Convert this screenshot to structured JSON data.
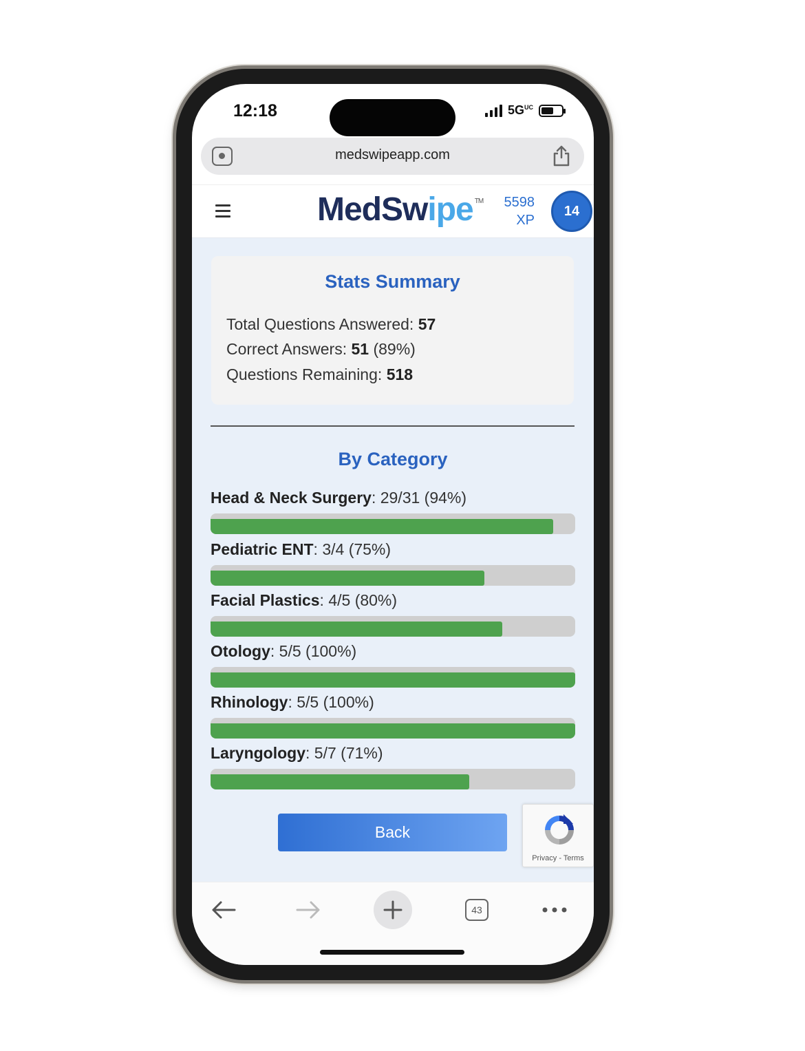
{
  "status_bar": {
    "time": "12:18",
    "network": "5G",
    "network_suffix": "UC"
  },
  "browser": {
    "url": "medswipeapp.com",
    "tabs_count": "43"
  },
  "header": {
    "logo_part1": "MedSw",
    "logo_part2": "ipe",
    "logo_tm": "TM",
    "xp_value": "5598",
    "xp_unit": "XP",
    "level": "14"
  },
  "summary": {
    "title": "Stats Summary",
    "total_label": "Total Questions Answered: ",
    "total_value": "57",
    "correct_label": "Correct Answers: ",
    "correct_value": "51",
    "correct_pct": " (89%)",
    "remaining_label": "Questions Remaining: ",
    "remaining_value": "518"
  },
  "categories_title": "By Category",
  "categories": [
    {
      "name": "Head & Neck Surgery",
      "detail": ": 29/31 (94%)",
      "progress": 0.94
    },
    {
      "name": "Pediatric ENT",
      "detail": ": 3/4 (75%)",
      "progress": 0.75
    },
    {
      "name": "Facial Plastics",
      "detail": ": 4/5 (80%)",
      "progress": 0.8
    },
    {
      "name": "Otology",
      "detail": ": 5/5 (100%)",
      "progress": 1.0
    },
    {
      "name": "Rhinology",
      "detail": ": 5/5 (100%)",
      "progress": 1.0
    },
    {
      "name": "Laryngology",
      "detail": ": 5/7 (71%)",
      "progress": 0.71
    }
  ],
  "back_label": "Back",
  "recaptcha": {
    "links": "Privacy - Terms"
  },
  "colors": {
    "accent": "#2a62bf",
    "progress_fill": "#4ea24e",
    "progress_track": "#cfcfcf",
    "button": "#2f6fd3"
  }
}
